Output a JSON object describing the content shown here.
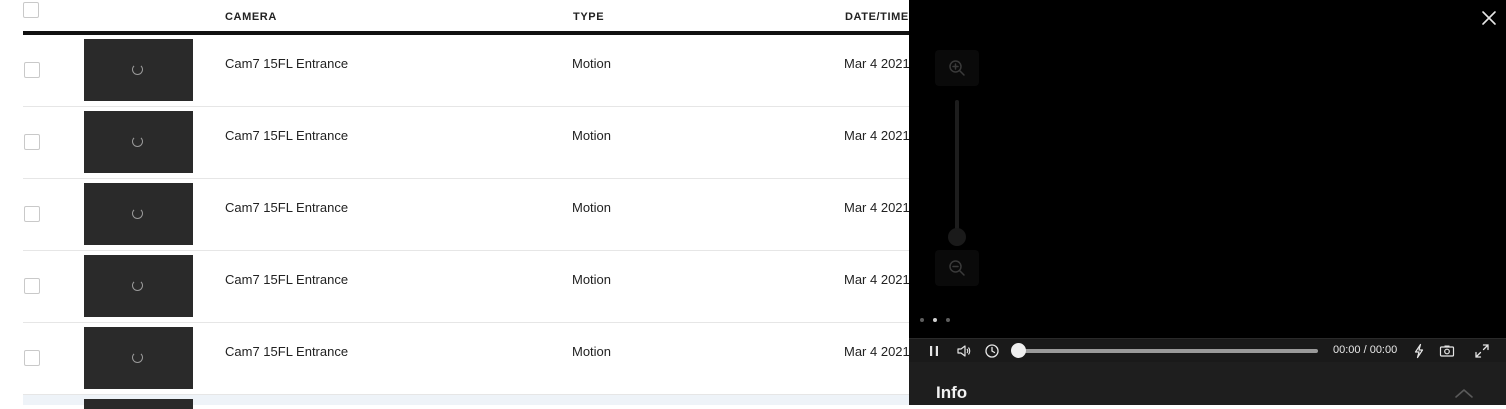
{
  "table": {
    "headers": {
      "camera": "CAMERA",
      "type": "TYPE",
      "datetime": "DATE/TIME"
    },
    "rows": [
      {
        "camera": "Cam7 15FL Entrance",
        "type": "Motion",
        "datetime": "Mar 4 2021"
      },
      {
        "camera": "Cam7 15FL Entrance",
        "type": "Motion",
        "datetime": "Mar 4 2021"
      },
      {
        "camera": "Cam7 15FL Entrance",
        "type": "Motion",
        "datetime": "Mar 4 2021"
      },
      {
        "camera": "Cam7 15FL Entrance",
        "type": "Motion",
        "datetime": "Mar 4 2021"
      },
      {
        "camera": "Cam7 15FL Entrance",
        "type": "Motion",
        "datetime": "Mar 4 2021"
      }
    ]
  },
  "player": {
    "time_display": "00:00 / 00:00",
    "progress": 0,
    "info_title": "Info",
    "icons": {
      "close": "close-icon",
      "zoom_in": "zoom-in-icon",
      "zoom_out": "zoom-out-icon",
      "pause": "pause-icon",
      "volume": "volume-icon",
      "history": "clock-icon",
      "speed": "lightning-icon",
      "snapshot": "camera-icon",
      "fullscreen": "fullscreen-icon",
      "collapse": "chevron-up-icon"
    }
  }
}
